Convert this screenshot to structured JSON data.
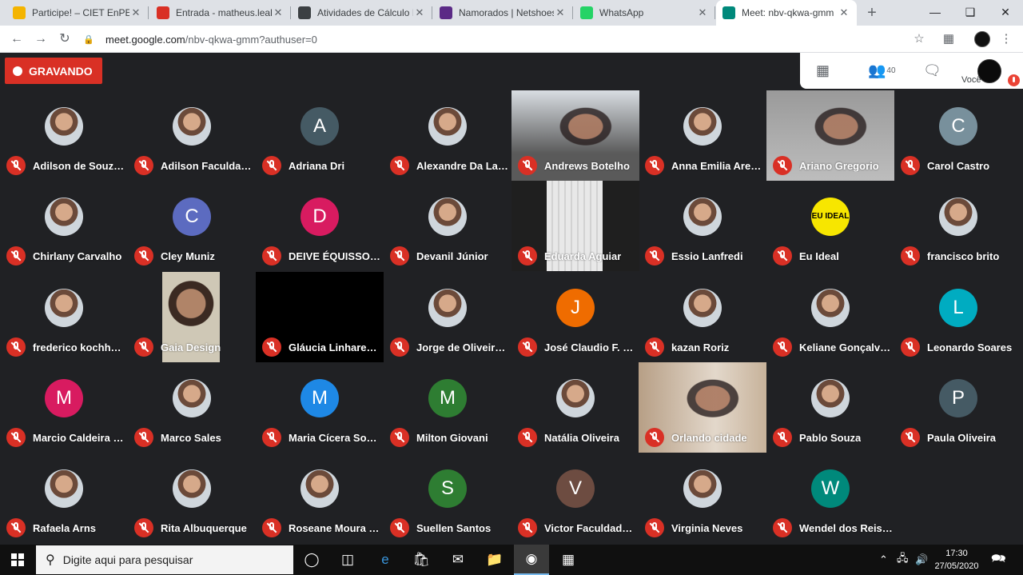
{
  "browser": {
    "tabs": [
      {
        "title": "Participe! – CIET EnPED",
        "favicon_color": "#f4b400"
      },
      {
        "title": "Entrada - matheus.leal@",
        "favicon_color": "#d93025"
      },
      {
        "title": "Atividades de Cálculo Ir",
        "favicon_color": "#3c4043"
      },
      {
        "title": "Namorados | Netshoes",
        "favicon_color": "#5b2a86"
      },
      {
        "title": "WhatsApp",
        "favicon_color": "#25d366"
      },
      {
        "title": "Meet: nbv-qkwa-gmm",
        "favicon_color": "#00897b",
        "active": true
      }
    ],
    "url_host": "meet.google.com",
    "url_path": "/nbv-qkwa-gmm?authuser=0"
  },
  "meet": {
    "recording_label": "GRAVANDO",
    "participant_count": "40",
    "self_label": "Você"
  },
  "participants": [
    {
      "name": "Adilson de Souza ...",
      "kind": "photo"
    },
    {
      "name": "Adilson Faculdade...",
      "kind": "photo"
    },
    {
      "name": "Adriana Dri",
      "kind": "letter",
      "letter": "A",
      "color": "#455a64"
    },
    {
      "name": "Alexandre Da Lam...",
      "kind": "photo"
    },
    {
      "name": "Andrews Botelho",
      "kind": "video"
    },
    {
      "name": "Anna Emilia Arend ...",
      "kind": "photo"
    },
    {
      "name": "Ariano Gregorio",
      "kind": "video"
    },
    {
      "name": "Carol Castro",
      "kind": "letter",
      "letter": "C",
      "color": "#78909c"
    },
    {
      "name": "Chirlany Carvalho",
      "kind": "photo"
    },
    {
      "name": "Cley Muniz",
      "kind": "letter",
      "letter": "C",
      "color": "#5c6bc0"
    },
    {
      "name": "DEIVE ÉQUISSON ...",
      "kind": "letter",
      "letter": "D",
      "color": "#d81b60"
    },
    {
      "name": "Devanil Júnior",
      "kind": "photo"
    },
    {
      "name": "Eduarda Aguiar",
      "kind": "video"
    },
    {
      "name": "Essio Lanfredi",
      "kind": "photo"
    },
    {
      "name": "Eu Ideal",
      "kind": "logo",
      "letter": "EU IDEAL",
      "color": "#f7e600"
    },
    {
      "name": "francisco brito",
      "kind": "photo"
    },
    {
      "name": "frederico kochhann",
      "kind": "photo"
    },
    {
      "name": "Gaia Design",
      "kind": "video"
    },
    {
      "name": "Gláucia Linhares P...",
      "kind": "video"
    },
    {
      "name": "Jorge de Oliveira Gil",
      "kind": "photo"
    },
    {
      "name": "José Claudio F. Go...",
      "kind": "letter",
      "letter": "J",
      "color": "#ef6c00"
    },
    {
      "name": "kazan Roriz",
      "kind": "photo"
    },
    {
      "name": "Keliane Gonçalves ...",
      "kind": "photo"
    },
    {
      "name": "Leonardo Soares",
      "kind": "letter",
      "letter": "L",
      "color": "#00acc1"
    },
    {
      "name": "Marcio Caldeira Ju...",
      "kind": "letter",
      "letter": "M",
      "color": "#d81b60"
    },
    {
      "name": "Marco Sales",
      "kind": "photo"
    },
    {
      "name": "Maria Cícera Souz...",
      "kind": "letter",
      "letter": "M",
      "color": "#1e88e5"
    },
    {
      "name": "Milton Giovani",
      "kind": "letter",
      "letter": "M",
      "color": "#2e7d32"
    },
    {
      "name": "Natália Oliveira",
      "kind": "photo"
    },
    {
      "name": "Orlando cidade",
      "kind": "video"
    },
    {
      "name": "Pablo Souza",
      "kind": "photo"
    },
    {
      "name": "Paula Oliveira",
      "kind": "letter",
      "letter": "P",
      "color": "#455a64"
    },
    {
      "name": "Rafaela Arns",
      "kind": "photo"
    },
    {
      "name": "Rita Albuquerque",
      "kind": "photo"
    },
    {
      "name": "Roseane Moura Ro...",
      "kind": "photo"
    },
    {
      "name": "Suellen Santos",
      "kind": "letter",
      "letter": "S",
      "color": "#2e7d32"
    },
    {
      "name": "Victor Faculdade S...",
      "kind": "letter",
      "letter": "V",
      "color": "#6d4c41"
    },
    {
      "name": "Virginia Neves",
      "kind": "photo"
    },
    {
      "name": "Wendel dos Reis Li...",
      "kind": "letter",
      "letter": "W",
      "color": "#00897b"
    }
  ],
  "taskbar": {
    "search_placeholder": "Digite aqui para pesquisar",
    "time": "17:30",
    "date": "27/05/2020"
  }
}
